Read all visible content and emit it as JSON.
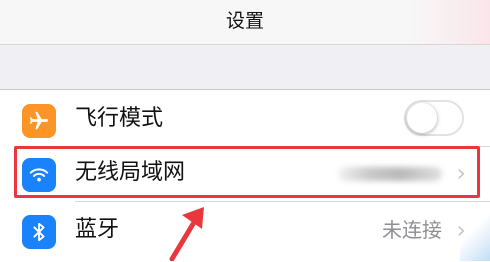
{
  "navbar": {
    "title": "设置"
  },
  "rows": [
    {
      "label": "飞行模式",
      "icon": "airplane-icon",
      "color": "#fd9426",
      "toggle_on": false
    },
    {
      "label": "无线局域网",
      "icon": "wifi-icon",
      "color": "#1a82fb",
      "value": "",
      "value_obscured": true
    },
    {
      "label": "蓝牙",
      "icon": "bluetooth-icon",
      "color": "#1a82fb",
      "value": "未连接"
    }
  ],
  "annotation": {
    "highlight_color": "#e8383d",
    "highlighted_row": "无线局域网"
  }
}
